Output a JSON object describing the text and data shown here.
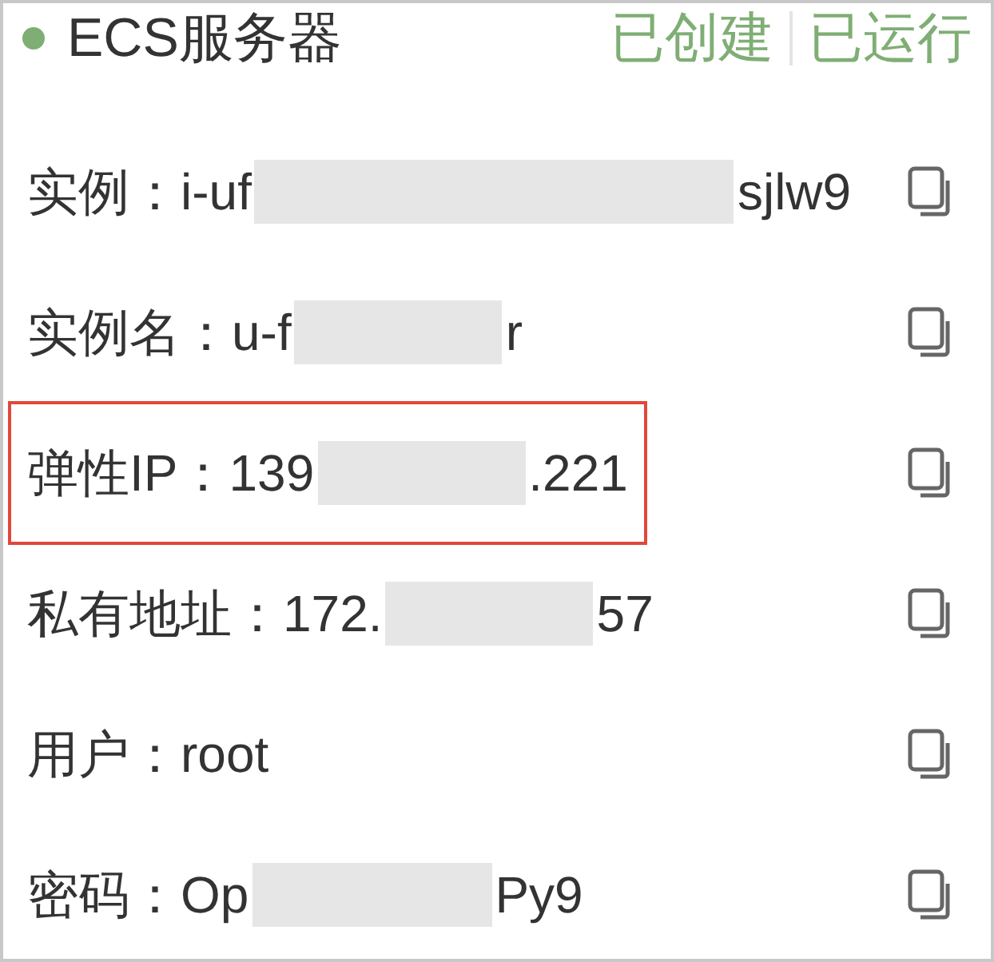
{
  "header": {
    "title": "ECS服务器",
    "statuses": [
      "已创建",
      "已运行"
    ]
  },
  "rows": [
    {
      "label": "实例：",
      "head": "i-uf",
      "tail": "sjlw9",
      "redacted": true,
      "highlighted": false
    },
    {
      "label": "实例名：",
      "head": "u-f",
      "tail": "r",
      "redacted": true,
      "highlighted": false
    },
    {
      "label": "弹性IP：",
      "head": "139",
      "tail": ".221",
      "redacted": true,
      "highlighted": true
    },
    {
      "label": "私有地址：",
      "head": "172.",
      "tail": "57",
      "redacted": true,
      "highlighted": false
    },
    {
      "label": "用户：",
      "head": "root",
      "highlighted": false
    },
    {
      "label": "密码：",
      "head": "Op",
      "tail": "Py9",
      "redacted": true,
      "highlighted": false
    }
  ]
}
